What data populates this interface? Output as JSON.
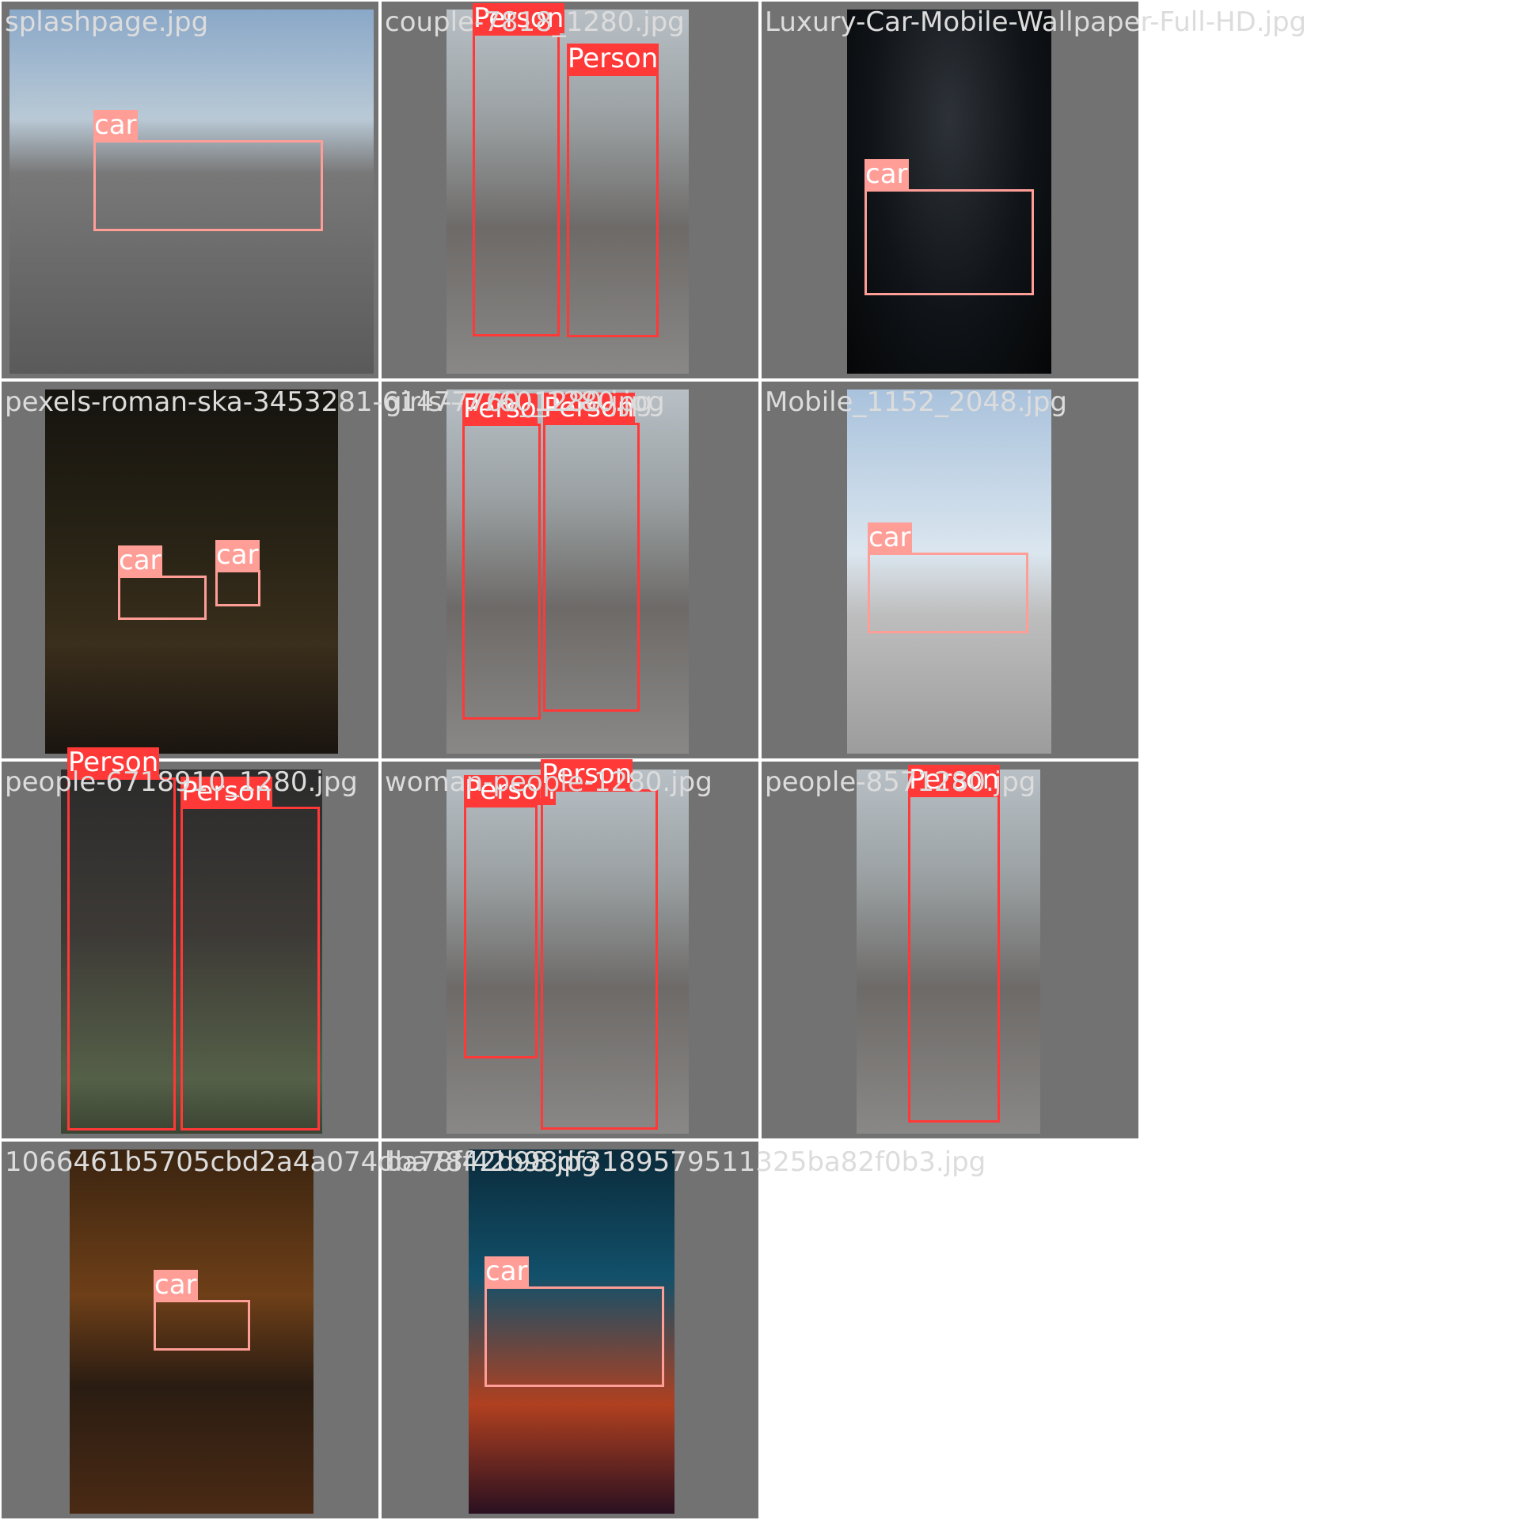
{
  "mosaic": {
    "tiles": [
      {
        "filename": "splashpage.jpg",
        "scene": "bg-street",
        "detections": [
          {
            "label": "car",
            "color": "#ff9d97"
          }
        ]
      },
      {
        "filename": "couple-7818_1280.jpg",
        "scene": "bg-city",
        "detections": [
          {
            "label": "Person",
            "color": "#ff3838"
          },
          {
            "label": "Person",
            "color": "#ff3838"
          }
        ]
      },
      {
        "filename": "Luxury-Car-Mobile-Wallpaper-Full-HD.jpg",
        "scene": "bg-dark",
        "detections": [
          {
            "label": "car",
            "color": "#ff9d97"
          }
        ]
      },
      {
        "filename": "pexels-roman-ska-3453281-6147–7760_1280.jpg",
        "scene": "bg-night",
        "detections": [
          {
            "label": "car",
            "color": "#ff9d97"
          },
          {
            "label": "car",
            "color": "#ff9d97"
          }
        ]
      },
      {
        "filename": "girls-7760_1280.jpg",
        "scene": "bg-city",
        "detections": [
          {
            "label": "Perso",
            "color": "#ff3838"
          },
          {
            "label": "Person",
            "color": "#ff3838"
          }
        ]
      },
      {
        "filename": "Mobile_1152_2048.jpg",
        "scene": "bg-sky",
        "detections": [
          {
            "label": "car",
            "color": "#ff9d97"
          }
        ]
      },
      {
        "filename": "people-6718910_1280.jpg",
        "scene": "bg-gate",
        "detections": [
          {
            "label": "Person",
            "color": "#ff3838"
          },
          {
            "label": "Person",
            "color": "#ff3838"
          }
        ]
      },
      {
        "filename": "woman-people-1280.jpg",
        "scene": "bg-city",
        "detections": [
          {
            "label": "Person",
            "color": "#ff3838"
          },
          {
            "label": "Person",
            "color": "#ff3838"
          }
        ]
      },
      {
        "filename": "people-8571280.jpg",
        "scene": "bg-city",
        "detections": [
          {
            "label": "Person",
            "color": "#ff3838"
          }
        ]
      },
      {
        "filename": "1066461b5705cbd2a4a074dba78f42b98df3189579511325ba82f0b3.jpg",
        "scene": "bg-forest",
        "detections": [
          {
            "label": "car",
            "color": "#ff9d97"
          }
        ]
      },
      {
        "filename": "ba78f42b98.jpg",
        "scene": "bg-neon",
        "detections": [
          {
            "label": "car",
            "color": "#ff9d97"
          }
        ]
      }
    ]
  }
}
